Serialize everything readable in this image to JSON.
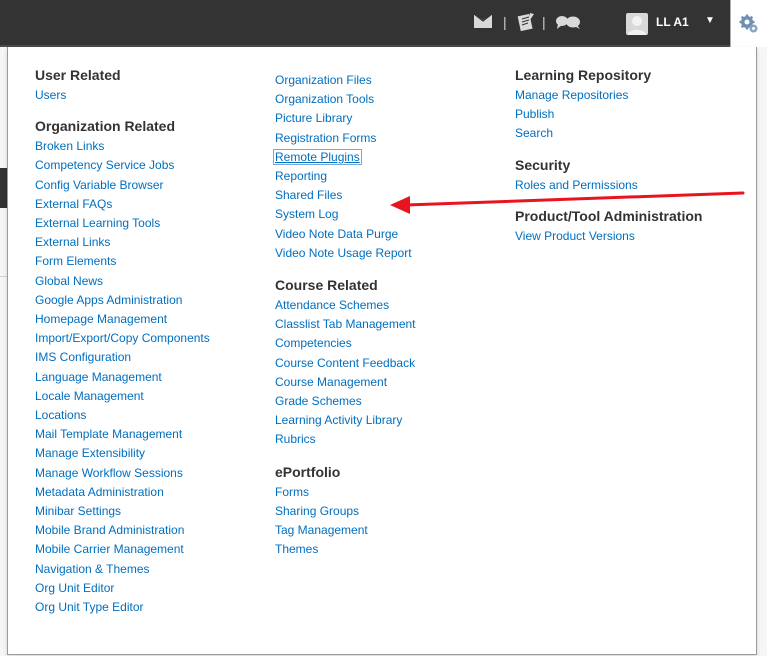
{
  "topbar": {
    "user_label": "LL A1",
    "separator": "|",
    "icons": [
      "mail-icon",
      "notebook-icon",
      "chat-icon",
      "user-avatar-icon",
      "caret-down-icon",
      "gear-icon"
    ]
  },
  "colors": {
    "topbar_bg": "#333333",
    "link": "#006fbf",
    "heading": "#333333",
    "arrow": "#e8141e"
  },
  "menu": {
    "col1": {
      "sections": [
        {
          "heading": "User Related",
          "items": [
            "Users"
          ]
        },
        {
          "heading": "Organization Related",
          "items": [
            "Broken Links",
            "Competency Service Jobs",
            "Config Variable Browser",
            "External FAQs",
            "External Learning Tools",
            "External Links",
            "Form Elements",
            "Global News",
            "Google Apps Administration",
            "Homepage Management",
            "Import/Export/Copy Components",
            "IMS Configuration",
            "Language Management",
            "Locale Management",
            "Locations",
            "Mail Template Management",
            "Manage Extensibility",
            "Manage Workflow Sessions",
            "Metadata Administration",
            "Minibar Settings",
            "Mobile Brand Administration",
            "Mobile Carrier Management",
            "Navigation & Themes",
            "Org Unit Editor",
            "Org Unit Type Editor"
          ]
        }
      ]
    },
    "col2": {
      "items_top": [
        "Organization Files",
        "Organization Tools",
        "Picture Library",
        "Registration Forms",
        "Remote Plugins",
        "Reporting",
        "Shared Files",
        "System Log",
        "Video Note Data Purge",
        "Video Note Usage Report"
      ],
      "highlighted_item": "Remote Plugins",
      "sections": [
        {
          "heading": "Course Related",
          "items": [
            "Attendance Schemes",
            "Classlist Tab Management",
            "Competencies",
            "Course Content Feedback",
            "Course Management",
            "Grade Schemes",
            "Learning Activity Library",
            "Rubrics"
          ]
        },
        {
          "heading": "ePortfolio",
          "items": [
            "Forms",
            "Sharing Groups",
            "Tag Management",
            "Themes"
          ]
        }
      ]
    },
    "col3": {
      "sections": [
        {
          "heading": "Learning Repository",
          "items": [
            "Manage Repositories",
            "Publish",
            "Search"
          ]
        },
        {
          "heading": "Security",
          "items": [
            "Roles and Permissions"
          ]
        },
        {
          "heading": "Product/Tool Administration",
          "items": [
            "View Product Versions"
          ]
        }
      ]
    }
  }
}
